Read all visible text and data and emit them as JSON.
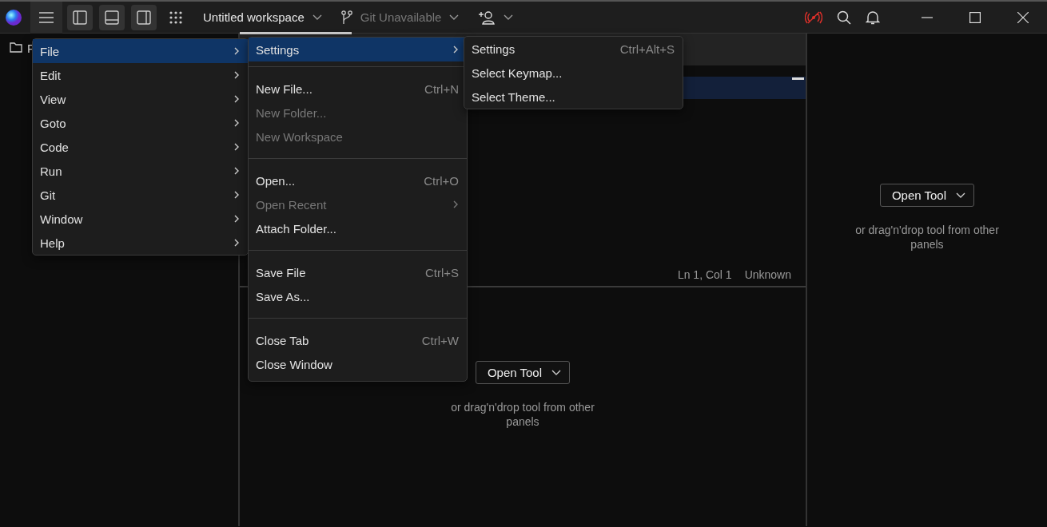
{
  "title_bar": {
    "workspace": "Untitled workspace",
    "git": "Git Unavailable",
    "panel_toggles": [
      {
        "kind": "left",
        "on": true
      },
      {
        "kind": "bottom",
        "on": true
      },
      {
        "kind": "right",
        "on": true
      }
    ]
  },
  "sidebar": {
    "label": "F"
  },
  "main_menu": [
    {
      "label": "File",
      "selected": true
    },
    {
      "label": "Edit",
      "selected": false
    },
    {
      "label": "View",
      "selected": false
    },
    {
      "label": "Goto",
      "selected": false
    },
    {
      "label": "Code",
      "selected": false
    },
    {
      "label": "Run",
      "selected": false
    },
    {
      "label": "Git",
      "selected": false
    },
    {
      "label": "Window",
      "selected": false
    },
    {
      "label": "Help",
      "selected": false
    }
  ],
  "file_menu": [
    [
      {
        "label": "Settings",
        "submenu": true,
        "selected": true,
        "disabled": false
      }
    ],
    [
      {
        "label": "New File...",
        "shortcut": "Ctrl+N",
        "selected": false,
        "disabled": false
      },
      {
        "label": "New Folder...",
        "selected": false,
        "disabled": true
      },
      {
        "label": "New Workspace",
        "selected": false,
        "disabled": true
      }
    ],
    [
      {
        "label": "Open...",
        "shortcut": "Ctrl+O",
        "selected": false,
        "disabled": false
      },
      {
        "label": "Open Recent",
        "submenu": true,
        "selected": false,
        "disabled": true
      },
      {
        "label": "Attach Folder...",
        "selected": false,
        "disabled": false
      }
    ],
    [
      {
        "label": "Save File",
        "shortcut": "Ctrl+S",
        "selected": false,
        "disabled": false
      },
      {
        "label": "Save As...",
        "selected": false,
        "disabled": false
      }
    ],
    [
      {
        "label": "Close Tab",
        "shortcut": "Ctrl+W",
        "selected": false,
        "disabled": false
      },
      {
        "label": "Close Window",
        "selected": false,
        "disabled": false
      }
    ]
  ],
  "settings_menu": [
    {
      "label": "Settings",
      "shortcut": "Ctrl+Alt+S"
    },
    {
      "label": "Select Keymap..."
    },
    {
      "label": "Select Theme..."
    }
  ],
  "editor": {
    "position": "Ln 1, Col 1",
    "language": "Unknown"
  },
  "panels": [
    {
      "button": "Open Tool",
      "hint": "or drag'n'drop tool from other panels"
    },
    {
      "button": "Open Tool",
      "hint": "or drag'n'drop tool from other panels"
    }
  ]
}
